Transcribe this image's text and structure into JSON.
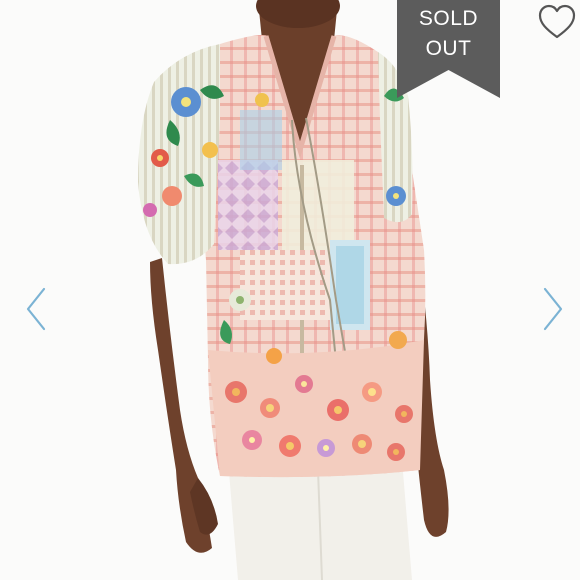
{
  "listing": {
    "status_badge": {
      "line1": "SOLD",
      "line2": "OUT"
    }
  },
  "colors": {
    "badge_bg": "#5c5c5c",
    "badge_text": "#ffffff",
    "arrow": "#7bb3d4",
    "heart_stroke": "#555555",
    "background": "#fbfbfa"
  },
  "icons": {
    "favorite": "heart-outline-icon",
    "previous": "chevron-left-icon",
    "next": "chevron-right-icon"
  }
}
